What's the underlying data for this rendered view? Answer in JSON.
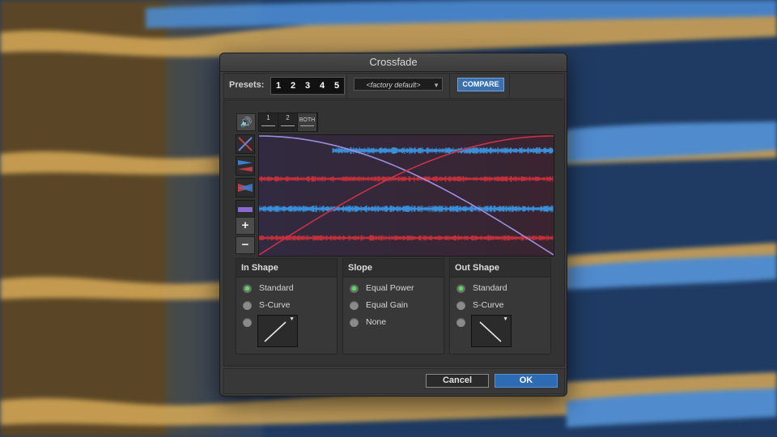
{
  "dialog": {
    "title": "Crossfade"
  },
  "presets": {
    "label": "Presets:",
    "buttons": [
      "1",
      "2",
      "3",
      "4",
      "5"
    ],
    "selected": "<factory default>",
    "compare_label": "COMPARE"
  },
  "toolbar": {
    "audition_icon": "speaker-icon",
    "tracks": [
      {
        "label": "1"
      },
      {
        "label": "2"
      },
      {
        "label": "BOTH"
      }
    ],
    "zoom_in_glyph": "+",
    "zoom_out_glyph": "−"
  },
  "in_shape": {
    "title": "In Shape",
    "options": [
      "Standard",
      "S-Curve"
    ],
    "selected": "Standard"
  },
  "slope": {
    "title": "Slope",
    "options": [
      "Equal Power",
      "Equal Gain",
      "None"
    ],
    "selected": "Equal Power"
  },
  "out_shape": {
    "title": "Out Shape",
    "options": [
      "Standard",
      "S-Curve"
    ],
    "selected": "Standard"
  },
  "footer": {
    "cancel_label": "Cancel",
    "ok_label": "OK"
  },
  "colors": {
    "fade_out_curve": "#9b8fe0",
    "fade_in_curve": "#c8324a",
    "waveform_blue": "#3a8fd8",
    "waveform_red": "#c0303a",
    "accent": "#2d6bb3"
  }
}
